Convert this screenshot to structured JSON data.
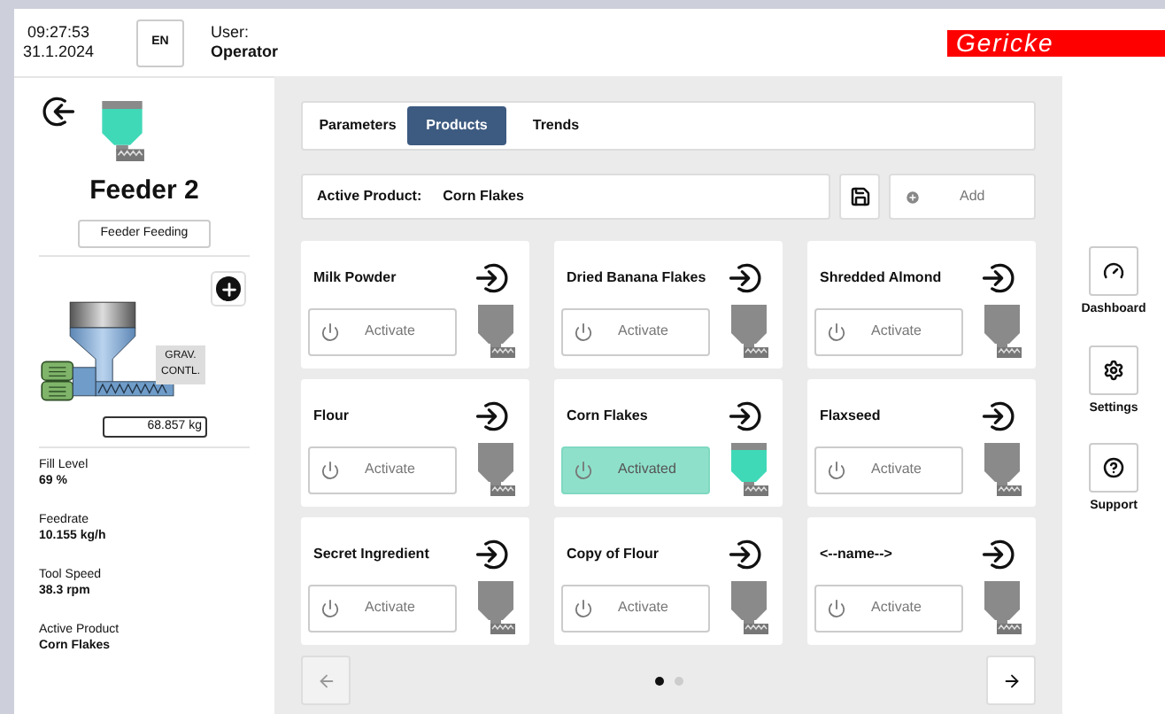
{
  "header": {
    "time": "09:27:53",
    "date": "31.1.2024",
    "language": "EN",
    "user_label": "User:",
    "user_name": "Operator",
    "logo": "Gericke"
  },
  "feeder": {
    "title": "Feeder 2",
    "status": "Feeder Feeding",
    "control_label": "GRAV. CONTL.",
    "weight": "68.857 kg",
    "stats": [
      {
        "label": "Fill Level",
        "value": "69 %"
      },
      {
        "label": "Feedrate",
        "value": "10.155 kg/h"
      },
      {
        "label": "Tool Speed",
        "value": "38.3 rpm"
      },
      {
        "label": "Active Product",
        "value": "Corn Flakes"
      }
    ]
  },
  "tabs": [
    {
      "label": "Parameters",
      "selected": false
    },
    {
      "label": "Products",
      "selected": true
    },
    {
      "label": "Trends",
      "selected": false
    }
  ],
  "active_product": {
    "label": "Active Product:",
    "value": "Corn Flakes"
  },
  "add_button": "Add",
  "products": [
    {
      "name": "Milk Powder",
      "action": "Activate",
      "active": false
    },
    {
      "name": "Dried Banana Flakes",
      "action": "Activate",
      "active": false
    },
    {
      "name": "Shredded Almond",
      "action": "Activate",
      "active": false
    },
    {
      "name": "Flour",
      "action": "Activate",
      "active": false
    },
    {
      "name": "Corn Flakes",
      "action": "Activated",
      "active": true
    },
    {
      "name": "Flaxseed",
      "action": "Activate",
      "active": false
    },
    {
      "name": "Secret Ingredient",
      "action": "Activate",
      "active": false
    },
    {
      "name": "Copy of Flour",
      "action": "Activate",
      "active": false
    },
    {
      "name": "<--name-->",
      "action": "Activate",
      "active": false
    }
  ],
  "pages": [
    {
      "selected": true
    },
    {
      "selected": false
    }
  ],
  "side_nav": [
    {
      "kind": "dashboard",
      "label": "Dashboard"
    },
    {
      "kind": "settings",
      "label": "Settings"
    },
    {
      "kind": "support",
      "label": "Support"
    }
  ]
}
